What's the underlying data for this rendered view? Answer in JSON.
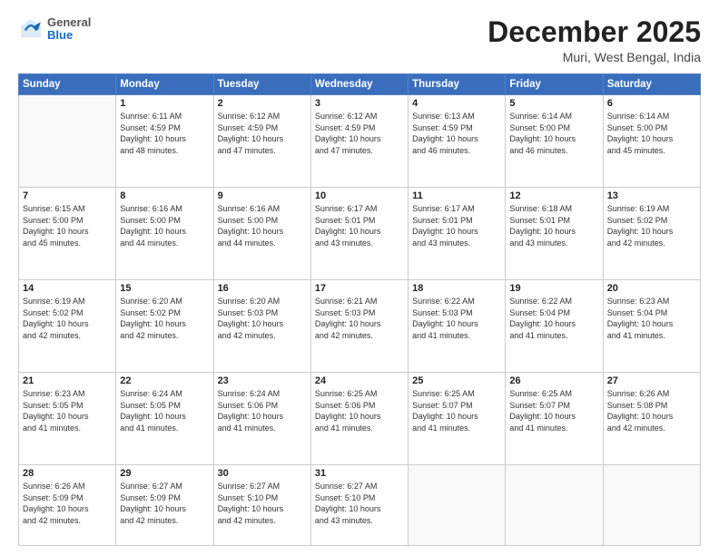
{
  "logo": {
    "general": "General",
    "blue": "Blue"
  },
  "header": {
    "month": "December 2025",
    "location": "Muri, West Bengal, India"
  },
  "weekdays": [
    "Sunday",
    "Monday",
    "Tuesday",
    "Wednesday",
    "Thursday",
    "Friday",
    "Saturday"
  ],
  "weeks": [
    [
      {
        "day": "",
        "info": ""
      },
      {
        "day": "1",
        "info": "Sunrise: 6:11 AM\nSunset: 4:59 PM\nDaylight: 10 hours\nand 48 minutes."
      },
      {
        "day": "2",
        "info": "Sunrise: 6:12 AM\nSunset: 4:59 PM\nDaylight: 10 hours\nand 47 minutes."
      },
      {
        "day": "3",
        "info": "Sunrise: 6:12 AM\nSunset: 4:59 PM\nDaylight: 10 hours\nand 47 minutes."
      },
      {
        "day": "4",
        "info": "Sunrise: 6:13 AM\nSunset: 4:59 PM\nDaylight: 10 hours\nand 46 minutes."
      },
      {
        "day": "5",
        "info": "Sunrise: 6:14 AM\nSunset: 5:00 PM\nDaylight: 10 hours\nand 46 minutes."
      },
      {
        "day": "6",
        "info": "Sunrise: 6:14 AM\nSunset: 5:00 PM\nDaylight: 10 hours\nand 45 minutes."
      }
    ],
    [
      {
        "day": "7",
        "info": "Sunrise: 6:15 AM\nSunset: 5:00 PM\nDaylight: 10 hours\nand 45 minutes."
      },
      {
        "day": "8",
        "info": "Sunrise: 6:16 AM\nSunset: 5:00 PM\nDaylight: 10 hours\nand 44 minutes."
      },
      {
        "day": "9",
        "info": "Sunrise: 6:16 AM\nSunset: 5:00 PM\nDaylight: 10 hours\nand 44 minutes."
      },
      {
        "day": "10",
        "info": "Sunrise: 6:17 AM\nSunset: 5:01 PM\nDaylight: 10 hours\nand 43 minutes."
      },
      {
        "day": "11",
        "info": "Sunrise: 6:17 AM\nSunset: 5:01 PM\nDaylight: 10 hours\nand 43 minutes."
      },
      {
        "day": "12",
        "info": "Sunrise: 6:18 AM\nSunset: 5:01 PM\nDaylight: 10 hours\nand 43 minutes."
      },
      {
        "day": "13",
        "info": "Sunrise: 6:19 AM\nSunset: 5:02 PM\nDaylight: 10 hours\nand 42 minutes."
      }
    ],
    [
      {
        "day": "14",
        "info": "Sunrise: 6:19 AM\nSunset: 5:02 PM\nDaylight: 10 hours\nand 42 minutes."
      },
      {
        "day": "15",
        "info": "Sunrise: 6:20 AM\nSunset: 5:02 PM\nDaylight: 10 hours\nand 42 minutes."
      },
      {
        "day": "16",
        "info": "Sunrise: 6:20 AM\nSunset: 5:03 PM\nDaylight: 10 hours\nand 42 minutes."
      },
      {
        "day": "17",
        "info": "Sunrise: 6:21 AM\nSunset: 5:03 PM\nDaylight: 10 hours\nand 42 minutes."
      },
      {
        "day": "18",
        "info": "Sunrise: 6:22 AM\nSunset: 5:03 PM\nDaylight: 10 hours\nand 41 minutes."
      },
      {
        "day": "19",
        "info": "Sunrise: 6:22 AM\nSunset: 5:04 PM\nDaylight: 10 hours\nand 41 minutes."
      },
      {
        "day": "20",
        "info": "Sunrise: 6:23 AM\nSunset: 5:04 PM\nDaylight: 10 hours\nand 41 minutes."
      }
    ],
    [
      {
        "day": "21",
        "info": "Sunrise: 6:23 AM\nSunset: 5:05 PM\nDaylight: 10 hours\nand 41 minutes."
      },
      {
        "day": "22",
        "info": "Sunrise: 6:24 AM\nSunset: 5:05 PM\nDaylight: 10 hours\nand 41 minutes."
      },
      {
        "day": "23",
        "info": "Sunrise: 6:24 AM\nSunset: 5:06 PM\nDaylight: 10 hours\nand 41 minutes."
      },
      {
        "day": "24",
        "info": "Sunrise: 6:25 AM\nSunset: 5:06 PM\nDaylight: 10 hours\nand 41 minutes."
      },
      {
        "day": "25",
        "info": "Sunrise: 6:25 AM\nSunset: 5:07 PM\nDaylight: 10 hours\nand 41 minutes."
      },
      {
        "day": "26",
        "info": "Sunrise: 6:25 AM\nSunset: 5:07 PM\nDaylight: 10 hours\nand 41 minutes."
      },
      {
        "day": "27",
        "info": "Sunrise: 6:26 AM\nSunset: 5:08 PM\nDaylight: 10 hours\nand 42 minutes."
      }
    ],
    [
      {
        "day": "28",
        "info": "Sunrise: 6:26 AM\nSunset: 5:09 PM\nDaylight: 10 hours\nand 42 minutes."
      },
      {
        "day": "29",
        "info": "Sunrise: 6:27 AM\nSunset: 5:09 PM\nDaylight: 10 hours\nand 42 minutes."
      },
      {
        "day": "30",
        "info": "Sunrise: 6:27 AM\nSunset: 5:10 PM\nDaylight: 10 hours\nand 42 minutes."
      },
      {
        "day": "31",
        "info": "Sunrise: 6:27 AM\nSunset: 5:10 PM\nDaylight: 10 hours\nand 43 minutes."
      },
      {
        "day": "",
        "info": ""
      },
      {
        "day": "",
        "info": ""
      },
      {
        "day": "",
        "info": ""
      }
    ]
  ]
}
